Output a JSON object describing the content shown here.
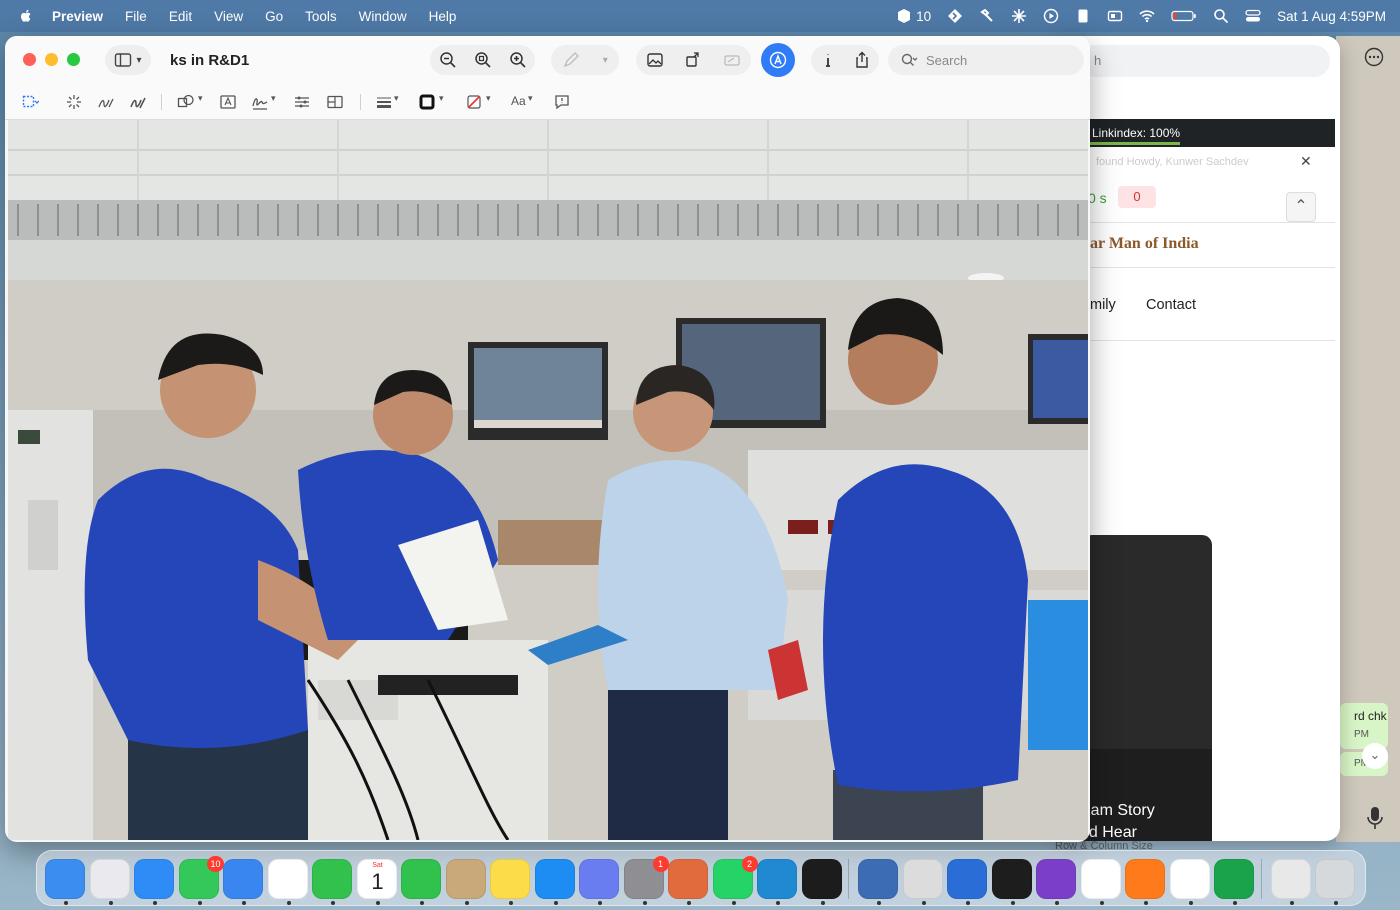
{
  "menubar": {
    "app_name": "Preview",
    "items": [
      "File",
      "Edit",
      "View",
      "Go",
      "Tools",
      "Window",
      "Help"
    ],
    "status_count": "10",
    "datetime": "Sat 1 Aug  4:59PM"
  },
  "window": {
    "title": "ks in R&D1",
    "search_placeholder": "Search",
    "text_style_label": "Aa"
  },
  "background_browser": {
    "search_fragment": "h",
    "linkindex": "Linkindex: 100%",
    "faded_text": "found    Howdy, Kunwer Sachdev",
    "zero_s": "0 s",
    "zero_badge": "0",
    "heading": "ar Man of India",
    "nav": [
      "mily",
      "Contact"
    ],
    "card_line1": "Kam Story",
    "card_line2": "nd Hear",
    "row_col": "Row & Column Size"
  },
  "chat_sliver": {
    "msg_text": "rd chk",
    "time1": "PM",
    "time2": "PM"
  },
  "dock": {
    "items": [
      {
        "name": "Finder",
        "color": "#3b8df0"
      },
      {
        "name": "Launchpad",
        "color": "#e9e9ee"
      },
      {
        "name": "Safari",
        "color": "#2f8cf7"
      },
      {
        "name": "Messages",
        "color": "#34c759",
        "badge": "10"
      },
      {
        "name": "Mail",
        "color": "#3a86f0"
      },
      {
        "name": "Photos",
        "color": "#ffffff"
      },
      {
        "name": "FaceTime",
        "color": "#33c14d"
      },
      {
        "name": "Calendar",
        "color": "#ffffff"
      },
      {
        "name": "Phone",
        "color": "#30c24c"
      },
      {
        "name": "Contacts",
        "color": "#c9a87a"
      },
      {
        "name": "Notes",
        "color": "#fddc4a"
      },
      {
        "name": "App Store",
        "color": "#1d8cf3"
      },
      {
        "name": "iPhone Mirroring",
        "color": "#6a7df0"
      },
      {
        "name": "System Settings",
        "color": "#8e8e93",
        "badge": "1"
      },
      {
        "name": "Claude",
        "color": "#e16b3d"
      },
      {
        "name": "WhatsApp",
        "color": "#25d366",
        "badge": "2"
      },
      {
        "name": "VS Code",
        "color": "#1f8ad2"
      },
      {
        "name": "Cursor",
        "color": "#1c1c1c"
      },
      {
        "name": "Ollama",
        "color": "#3c6cb4"
      },
      {
        "name": "Utility",
        "color": "#dcdcdc"
      },
      {
        "name": "Xcode Instruments",
        "color": "#2a6dd6"
      },
      {
        "name": "Terminal",
        "color": "#1d1d1d"
      },
      {
        "name": "GitHub Desktop",
        "color": "#7b3fc7"
      },
      {
        "name": "Chrome",
        "color": "#ffffff"
      },
      {
        "name": "Sublime Text",
        "color": "#ff7a1a"
      },
      {
        "name": "Anthropic",
        "color": "#ffffff"
      },
      {
        "name": "Numbers",
        "color": "#1aa34a"
      },
      {
        "name": "Documents",
        "color": "#e8e8e8"
      },
      {
        "name": "Trash",
        "color": "#d5d9dc"
      }
    ],
    "calendar_day": "1",
    "calendar_month": "Sat"
  },
  "colors": {
    "menubar_bg": "#4f79a6",
    "markup_accent": "#2f7cf6",
    "shirt_blue": "#2446b9"
  }
}
